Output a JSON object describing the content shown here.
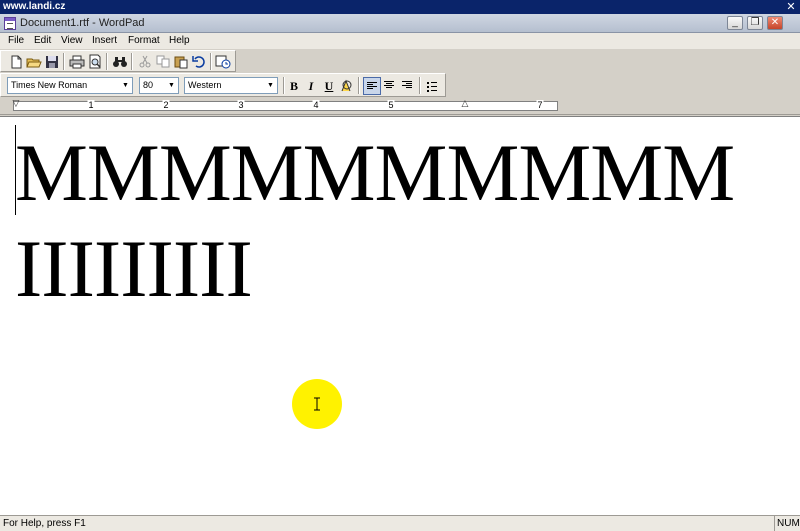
{
  "outer_window": {
    "title": "www.landi.cz",
    "close_glyph": "✕"
  },
  "window": {
    "title": "Document1.rtf - WordPad",
    "minimize_glyph": "_",
    "maximize_glyph": "❐",
    "close_glyph": "✕"
  },
  "menu": {
    "items": [
      {
        "label": "File"
      },
      {
        "label": "Edit"
      },
      {
        "label": "View"
      },
      {
        "label": "Insert"
      },
      {
        "label": "Format"
      },
      {
        "label": "Help"
      }
    ]
  },
  "toolbar": {
    "icons": [
      "new-document-icon",
      "open-folder-icon",
      "save-disk-icon",
      "print-icon",
      "print-preview-icon",
      "find-binoculars-icon",
      "cut-scissors-icon",
      "copy-icon",
      "paste-icon",
      "undo-icon",
      "insert-datetime-icon"
    ]
  },
  "format_bar": {
    "font_name": "Times New Roman",
    "font_size": "80",
    "script": "Western",
    "bold_label": "B",
    "italic_label": "I",
    "underline_label": "U"
  },
  "ruler": {
    "labels": [
      "1",
      "2",
      "3",
      "4",
      "5",
      "6",
      "7"
    ]
  },
  "document": {
    "lines": [
      "MMMMMMMMMM",
      "IIIIIIIII"
    ]
  },
  "status": {
    "help_text": "For Help, press F1",
    "num_indicator": "NUM"
  },
  "colors": {
    "cursor_highlight": "#fff200",
    "title_gradient": "#cfd6e2",
    "outer_bar": "#0a246a"
  }
}
